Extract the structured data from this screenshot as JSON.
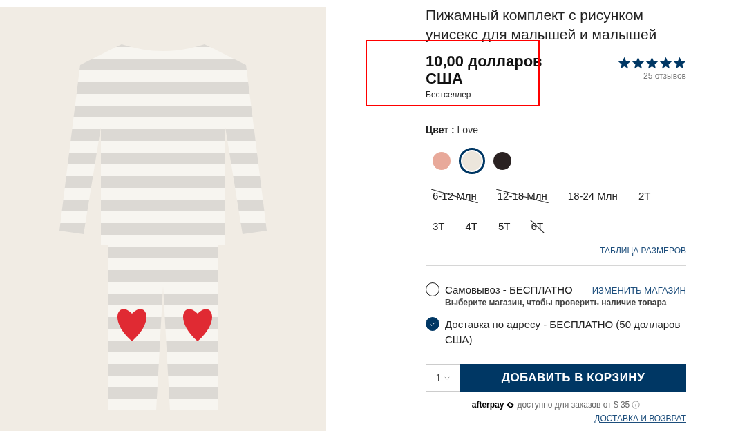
{
  "product": {
    "title": "Пижамный комплект с рисунком унисекс для малышей и малышей",
    "price": "10,00 долларов США",
    "price_highlighted": true,
    "badge": "Бестселлер"
  },
  "rating": {
    "stars": 5,
    "reviews": "25 отзывов"
  },
  "color": {
    "label": "Цвет :",
    "value": "Love"
  },
  "swatches": [
    {
      "selected": false,
      "color": "#e8a99a"
    },
    {
      "selected": true,
      "color": "#ece6dc"
    },
    {
      "selected": false,
      "color": "#2a2222"
    }
  ],
  "sizes": [
    {
      "label": "6-12 Млн",
      "available": false
    },
    {
      "label": "12-18 Млн",
      "available": false
    },
    {
      "label": "18-24 Млн",
      "available": true
    },
    {
      "label": "2T",
      "available": true
    },
    {
      "label": "3T",
      "available": true
    },
    {
      "label": "4T",
      "available": true
    },
    {
      "label": "5T",
      "available": true
    },
    {
      "label": "6T",
      "available": false
    }
  ],
  "size_chart_link": "ТАБЛИЦА РАЗМЕРОВ",
  "fulfillment": [
    {
      "label": "Самовывоз - БЕСПЛАТНО",
      "link": "ИЗМЕНИТЬ МАГАЗИН",
      "note": "Выберите магазин, чтобы проверить наличие товара",
      "selected": false
    },
    {
      "label": "Доставка по адресу - БЕСПЛАТНО (50 долларов США)",
      "selected": true
    }
  ],
  "quantity": "1",
  "add_to_cart": "ДОБАВИТЬ В КОРЗИНУ",
  "afterpay": {
    "logo": "afterpay",
    "text": "доступно для заказов от $ 35"
  },
  "shipping_link": "ДОСТАВКА И ВОЗВРАТ"
}
